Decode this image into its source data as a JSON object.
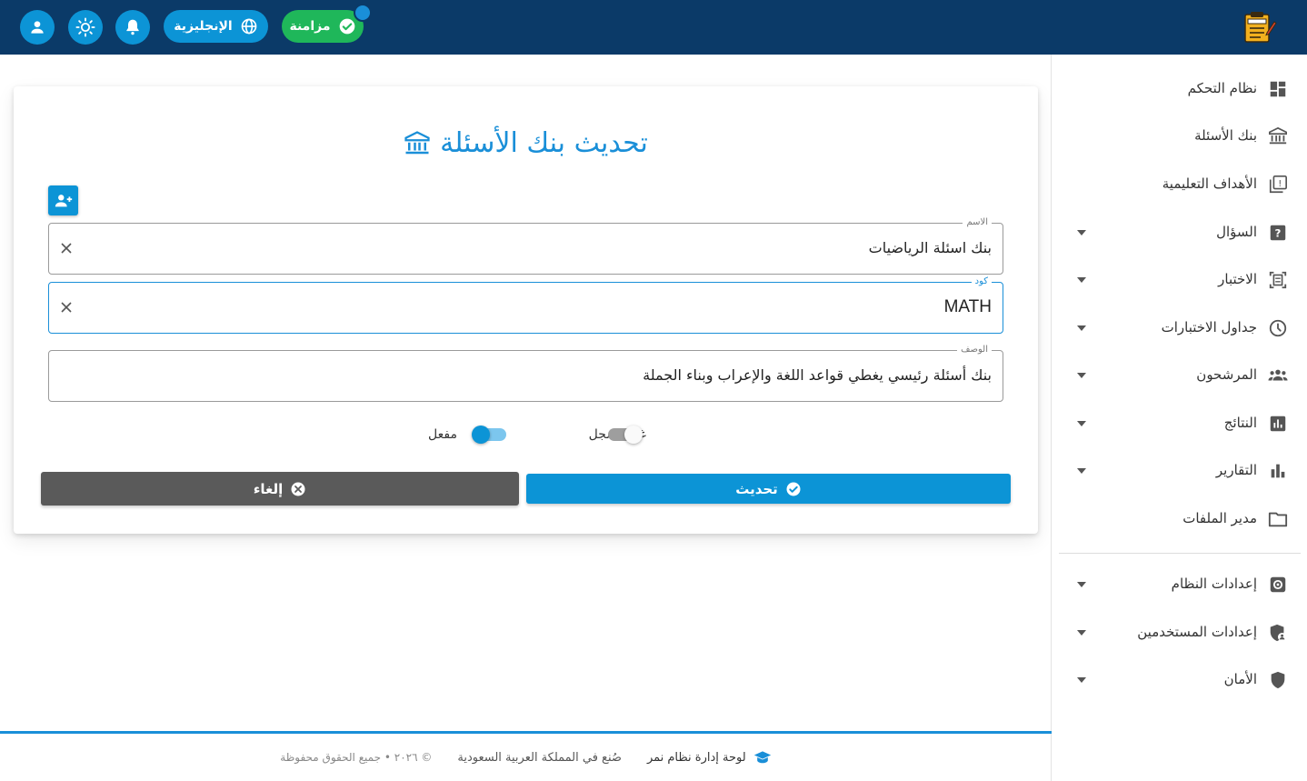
{
  "topbar": {
    "sync_label": "مزامنة",
    "language_label": "الإنجليزية",
    "icons": [
      "user-icon",
      "theme-sun-icon",
      "bell-icon",
      "globe-icon",
      "check-circle-icon",
      "exam-logo-icon"
    ]
  },
  "sidebar": {
    "items": [
      {
        "label": "نظام التحكم",
        "icon": "dashboard-icon",
        "has_caret": false
      },
      {
        "label": "بنك الأسئلة",
        "icon": "bank-icon",
        "has_caret": false
      },
      {
        "label": "الأهداف التعليمية",
        "icon": "objectives-icon",
        "has_caret": false
      },
      {
        "label": "السؤال",
        "icon": "question-icon",
        "has_caret": true
      },
      {
        "label": "الاختبار",
        "icon": "exam-icon",
        "has_caret": true
      },
      {
        "label": "جداول الاختبارات",
        "icon": "clock-icon",
        "has_caret": true
      },
      {
        "label": "المرشحون",
        "icon": "people-icon",
        "has_caret": true
      },
      {
        "label": "النتائج",
        "icon": "results-icon",
        "has_caret": true
      },
      {
        "label": "التقارير",
        "icon": "bar-chart-icon",
        "has_caret": true
      },
      {
        "label": "مدير الملفات",
        "icon": "folder-icon",
        "has_caret": false
      },
      {
        "label": "إعدادات النظام",
        "icon": "settings-icon",
        "has_caret": true
      },
      {
        "label": "إعدادات المستخدمين",
        "icon": "user-shield-icon",
        "has_caret": true
      },
      {
        "label": "الأمان",
        "icon": "shield-icon",
        "has_caret": true
      }
    ]
  },
  "form": {
    "title": "تحديث بنك الأسئلة",
    "name_label": "الاسم",
    "name_value": "بنك اسئلة الرياضيات",
    "code_label": "كود",
    "code_value": "MATH",
    "description_label": "الوصف",
    "description_value": "بنك أسئلة رئيسي يغطي قواعد اللغة والإعراب وبناء الجملة",
    "toggle_registered_label": "غير مسجل",
    "toggle_registered_on": false,
    "toggle_enabled_label": "مفعل",
    "toggle_enabled_on": true,
    "update_label": "تحديث",
    "cancel_label": "إلغاء"
  },
  "footer": {
    "brand": "لوحة إدارة نظام نمر",
    "made_in": "صُنع في المملكة العربية السعودية",
    "copyright": "© ٢٠٢٦ • جميع الحقوق محفوظة"
  },
  "colors": {
    "topbar": "#0b3a68",
    "accent": "#0c94d6",
    "success": "#1fb75a",
    "cancel": "#5a5a5a"
  }
}
